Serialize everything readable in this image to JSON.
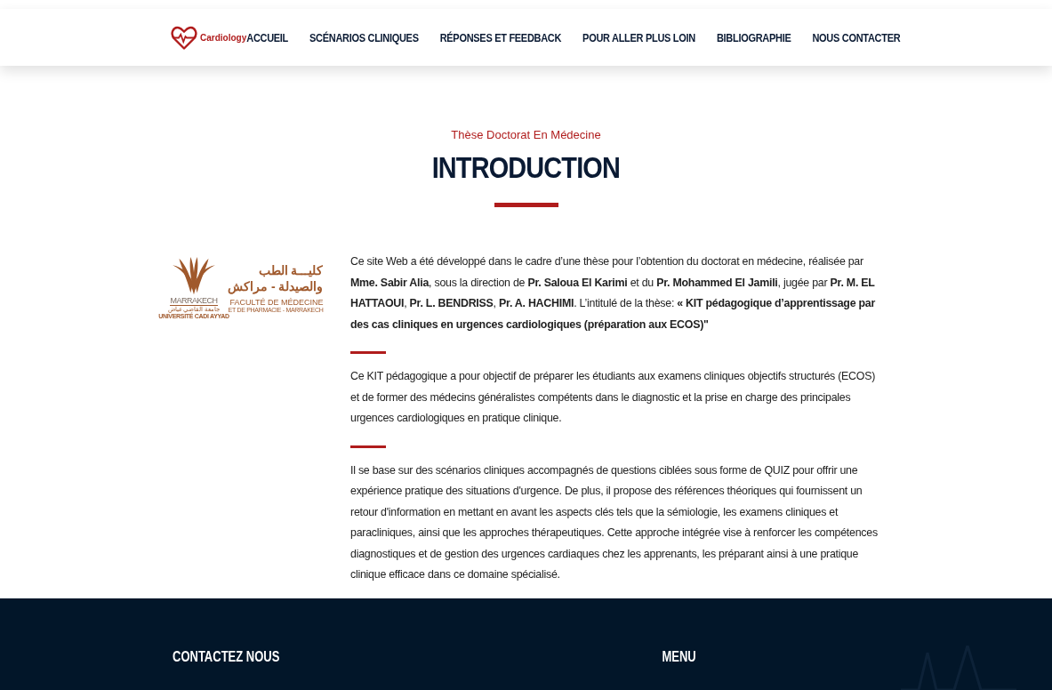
{
  "brand": {
    "name": "Cardiology"
  },
  "nav": [
    {
      "label": "ACCUEIL"
    },
    {
      "label": "SCÉNARIOS CLINIQUES"
    },
    {
      "label": "RÉPONSES ET FEEDBACK"
    },
    {
      "label": "POUR ALLER PLUS LOIN"
    },
    {
      "label": "BIBLIOGRAPHIE"
    },
    {
      "label": "NOUS CONTACTER"
    }
  ],
  "hero": {
    "subtitle": "Thèse Doctorat En Médecine",
    "title": "INTRODUCTION"
  },
  "faculty_logo": {
    "city": "MARRAKECH",
    "university_ar": "جامعة القاضي عياض",
    "university": "UNIVERSITÉ CADI AYYAD",
    "faculty_ar_1": "كليـــة الطب",
    "faculty_ar_2": "والصيدلة - مراكش",
    "faculty_1": "FACULTÉ DE MÉDECINE",
    "faculty_2": "ET DE PHARMACIE - MARRAKECH"
  },
  "paragraphs": [
    "Ce site Web a été développé dans le cadre d’une thèse pour l’obtention du doctorat en médecine, réalisée par **Mme. Sabir Alia**, sous la direction de **Pr. Saloua El Karimi** et du **Pr. Mohammed El Jamili**, jugée par **Pr. M. EL HATTAOUI**, **Pr. L. BENDRISS**, **Pr. A. HACHIMI**. L’intitulé de la thèse: **« KIT pédagogique d’apprentissage par des cas cliniques en urgences cardiologiques (préparation aux ECOS)\"**",
    "Ce KIT pédagogique a pour objectif de préparer les étudiants aux examens cliniques objectifs structurés (ECOS) et de former des médecins généralistes compétents dans le diagnostic et la prise en charge des principales urgences cardiologiques en pratique clinique.",
    "Il se base sur des scénarios cliniques accompagnés de questions ciblées sous forme de QUIZ pour offrir une expérience pratique des situations d'urgence. De plus, il propose des références théoriques qui fournissent un retour d'information en mettant en avant les aspects clés tels que la sémiologie, les examens cliniques et paracliniques, ainsi que les approches thérapeutiques. Cette approche intégrée vise à renforcer les compétences diagnostiques et de gestion des urgences cardiaques chez les apprenants, les préparant ainsi à une pratique clinique efficace dans ce domaine spécialisé."
  ],
  "footer": {
    "headings": [
      "CONTACTEZ NOUS",
      "MENU"
    ]
  }
}
